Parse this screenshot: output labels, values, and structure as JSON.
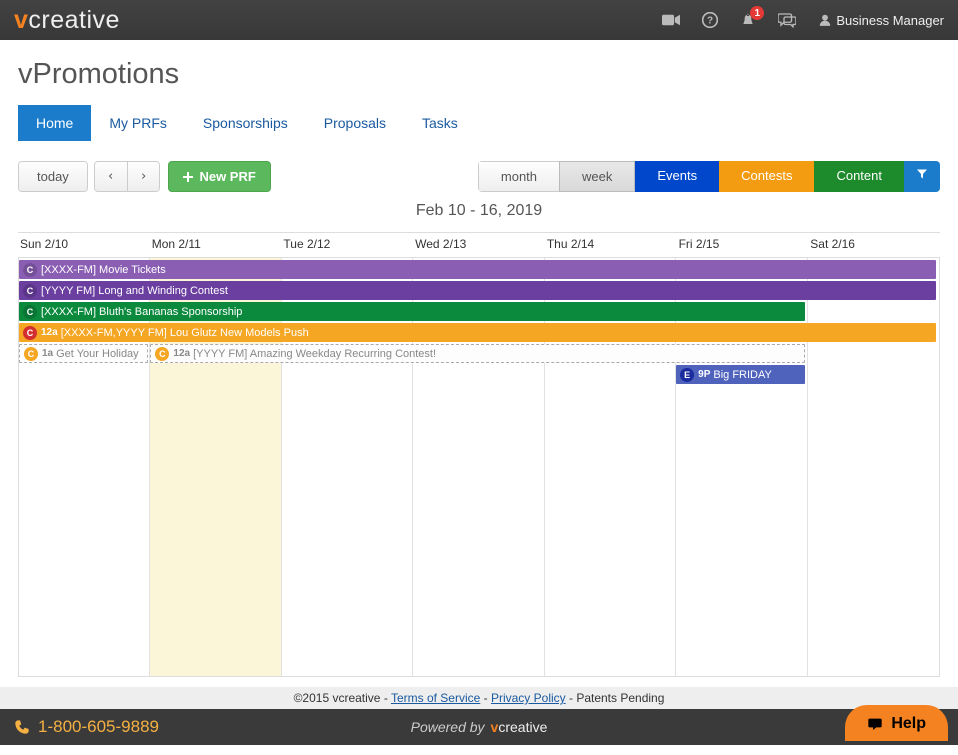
{
  "header": {
    "logo_prefix": "v",
    "logo_rest": "creative",
    "notif_count": "1",
    "user_label": "Business Manager"
  },
  "page": {
    "title": "vPromotions",
    "tabs": [
      {
        "label": "Home",
        "active": true
      },
      {
        "label": "My PRFs",
        "active": false
      },
      {
        "label": "Sponsorships",
        "active": false
      },
      {
        "label": "Proposals",
        "active": false
      },
      {
        "label": "Tasks",
        "active": false
      }
    ]
  },
  "toolbar": {
    "today": "today",
    "prev": "‹",
    "next": "›",
    "new_prf": "New PRF",
    "views": {
      "month": "month",
      "week": "week",
      "events": "Events",
      "contests": "Contests",
      "content": "Content"
    }
  },
  "calendar": {
    "range_label": "Feb 10 - 16, 2019",
    "days": [
      "Sun 2/10",
      "Mon 2/11",
      "Tue 2/12",
      "Wed 2/13",
      "Thu 2/14",
      "Fri 2/15",
      "Sat 2/16"
    ],
    "current_day_index": 1,
    "events": [
      {
        "row": 0,
        "start": 0,
        "span": 7,
        "cls": "purple",
        "badge": "C",
        "title": "[XXXX-FM] Movie Tickets"
      },
      {
        "row": 1,
        "start": 0,
        "span": 7,
        "cls": "purple2",
        "badge": "C",
        "title": "[YYYY FM] Long and Winding Contest"
      },
      {
        "row": 2,
        "start": 0,
        "span": 6,
        "cls": "green",
        "badge": "C",
        "title": "[XXXX-FM] Bluth's Bananas Sponsorship"
      },
      {
        "row": 3,
        "start": 0,
        "span": 7,
        "cls": "orange",
        "badge": "C",
        "badge_cls": "red",
        "time": "12a",
        "title": "[XXXX-FM,YYYY FM] Lou Glutz New Models Push"
      },
      {
        "row": 4,
        "start": 0,
        "span": 1,
        "cls": "dashed",
        "badge": "C",
        "time": "1a",
        "title": "Get Your Holiday"
      },
      {
        "row": 4,
        "start": 1,
        "span": 5,
        "cls": "dashed",
        "badge": "C",
        "time": "12a",
        "title": "[YYYY FM] Amazing Weekday Recurring Contest!"
      },
      {
        "row": 5,
        "start": 5,
        "span": 1,
        "cls": "blue",
        "badge": "E",
        "time": "9P",
        "title": "Big FRIDAY"
      }
    ]
  },
  "footer": {
    "copyright": "©2015 vcreative - ",
    "tos": "Terms of Service",
    "sep": " - ",
    "privacy": "Privacy Policy",
    "patents": " - Patents Pending",
    "phone": "1-800-605-9889",
    "powered": "Powered by",
    "help": "Help"
  }
}
